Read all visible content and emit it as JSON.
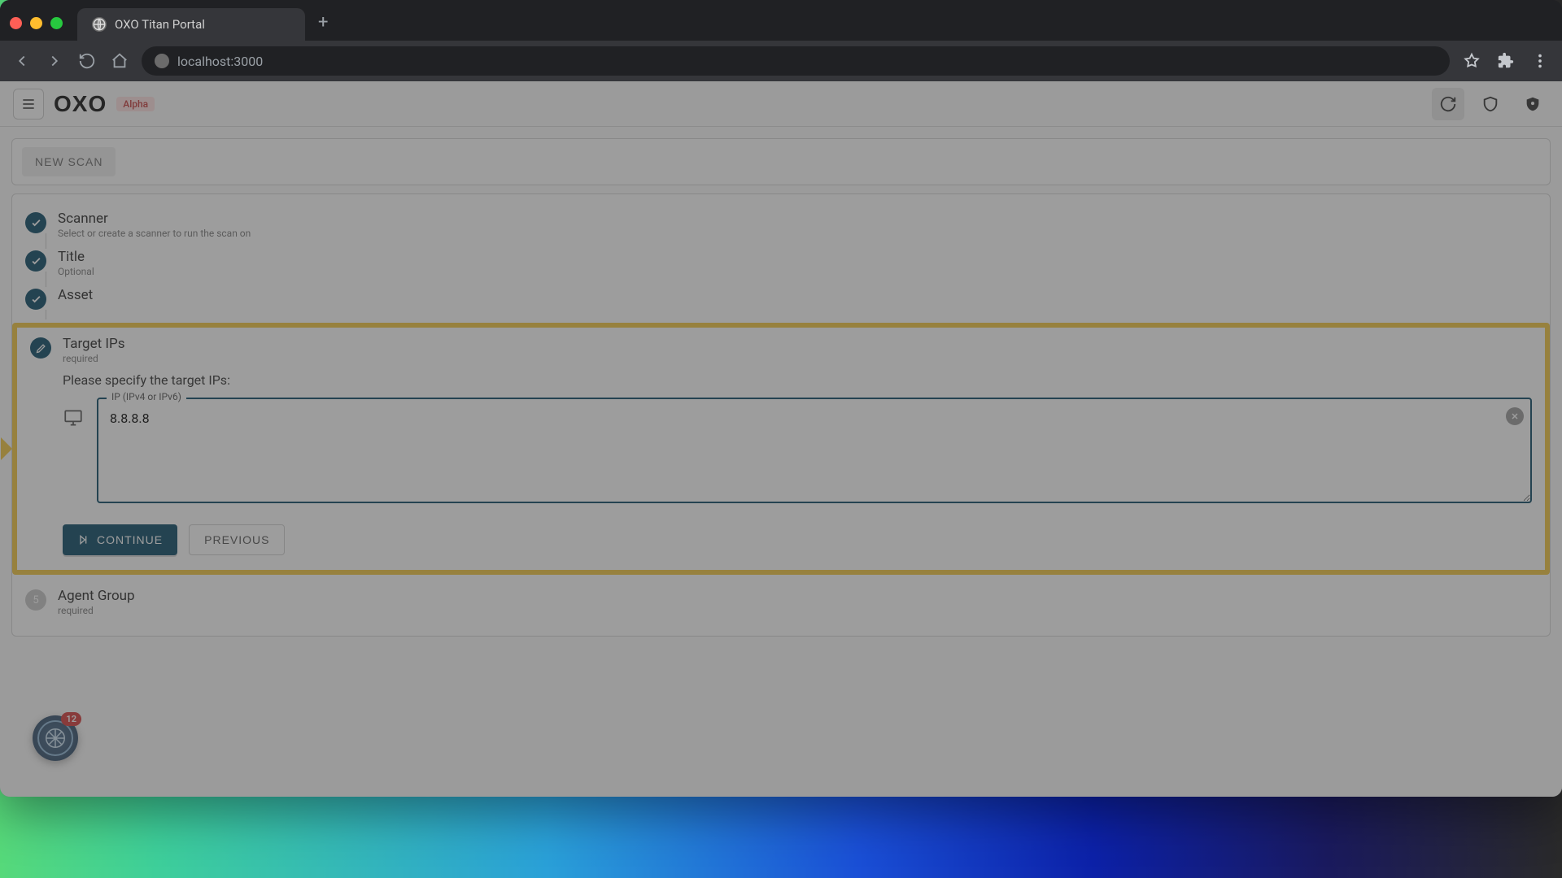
{
  "browser": {
    "tab_title": "OXO Titan Portal",
    "url": "localhost:3000"
  },
  "header": {
    "logo": "OXO",
    "badge": "Alpha"
  },
  "scan_bar": {
    "new_scan": "NEW SCAN"
  },
  "steps": {
    "scanner": {
      "title": "Scanner",
      "sub": "Select or create a scanner to run the scan on"
    },
    "title": {
      "title": "Title",
      "sub": "Optional"
    },
    "asset": {
      "title": "Asset",
      "sub": ""
    },
    "target": {
      "title": "Target IPs",
      "sub": "required"
    },
    "agent": {
      "title": "Agent Group",
      "sub": "required",
      "num": "5"
    }
  },
  "form": {
    "hint": "Please specify the target IPs:",
    "field_legend": "IP (IPv4 or IPv6)",
    "ip_value": "8.8.8.8",
    "continue": "CONTINUE",
    "previous": "PREVIOUS"
  },
  "float": {
    "count": "12"
  }
}
